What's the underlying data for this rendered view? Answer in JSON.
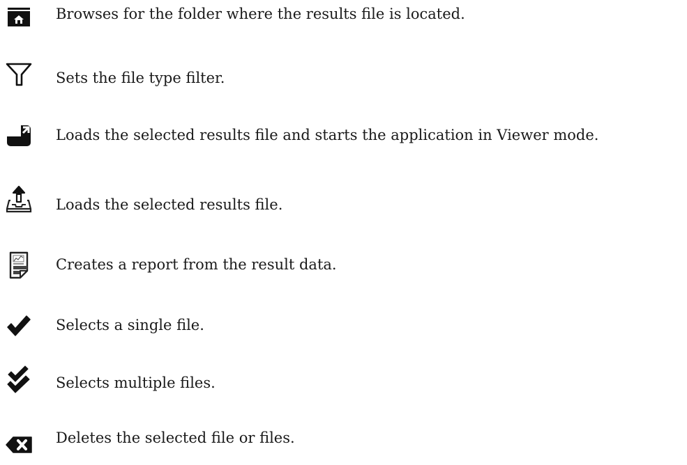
{
  "items": [
    {
      "icon": "folder-home-icon",
      "text": "Browses for the folder where the results file is located."
    },
    {
      "icon": "funnel-filter-icon",
      "text": "Sets the file type filter."
    },
    {
      "icon": "open-viewer-icon",
      "text": "Loads the selected results file and starts the application in Viewer mode."
    },
    {
      "icon": "upload-tray-icon",
      "text": "Loads the selected results file."
    },
    {
      "icon": "report-document-icon",
      "text": "Creates a report from the result data."
    },
    {
      "icon": "single-checkmark-icon",
      "text": "Selects a single file."
    },
    {
      "icon": "double-checkmark-icon",
      "text": "Selects multiple files."
    },
    {
      "icon": "delete-backspace-icon",
      "text": "Deletes the selected file or files."
    }
  ],
  "colors": {
    "icon": "#111111",
    "text": "#1a1a1a"
  }
}
